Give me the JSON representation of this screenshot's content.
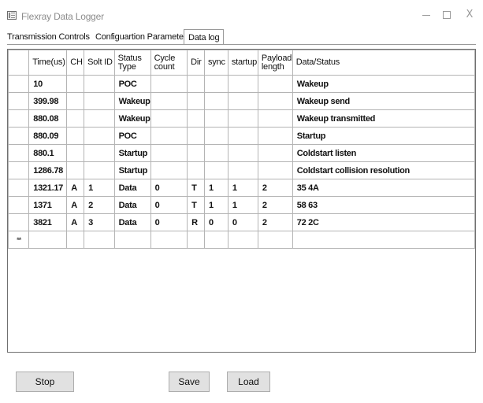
{
  "window": {
    "title": "Flexray Data Logger",
    "controls": {
      "minimize": "–",
      "maximize": "□",
      "close": "X"
    }
  },
  "tabs": [
    {
      "label": "Transmission Controls",
      "active": false
    },
    {
      "label": "Configuartion Parameter",
      "active": false
    },
    {
      "label": "Data log",
      "active": true
    }
  ],
  "table": {
    "columns": [
      "",
      "Time(us)",
      "CH",
      "Solt ID",
      "Status Type",
      "Cycle count",
      "Dir",
      "sync",
      "startup",
      "Payload length",
      "Data/Status"
    ],
    "rows": [
      [
        "",
        "10",
        "",
        "",
        "POC",
        "",
        "",
        "",
        "",
        "",
        "Wakeup"
      ],
      [
        "",
        "399.98",
        "",
        "",
        "Wakeup",
        "",
        "",
        "",
        "",
        "",
        "Wakeup send"
      ],
      [
        "",
        "880.08",
        "",
        "",
        "Wakeup",
        "",
        "",
        "",
        "",
        "",
        "Wakeup transmitted"
      ],
      [
        "",
        "880.09",
        "",
        "",
        "POC",
        "",
        "",
        "",
        "",
        "",
        "Startup"
      ],
      [
        "",
        "880.1",
        "",
        "",
        "Startup",
        "",
        "",
        "",
        "",
        "",
        "Coldstart listen"
      ],
      [
        "",
        "1286.78",
        "",
        "",
        "Startup",
        "",
        "",
        "",
        "",
        "",
        "Coldstart collision resolution"
      ],
      [
        "",
        "1321.17",
        "A",
        "1",
        "Data",
        "0",
        "T",
        "1",
        "1",
        "2",
        "35 4A"
      ],
      [
        "",
        "1371",
        "A",
        "2",
        "Data",
        "0",
        "T",
        "1",
        "1",
        "2",
        "58 63"
      ],
      [
        "",
        "3821",
        "A",
        "3",
        "Data",
        "0",
        "R",
        "0",
        "0",
        "2",
        "72 2C"
      ]
    ],
    "new_row_marker": "**"
  },
  "buttons": {
    "stop": "Stop",
    "save": "Save",
    "load": "Load"
  }
}
